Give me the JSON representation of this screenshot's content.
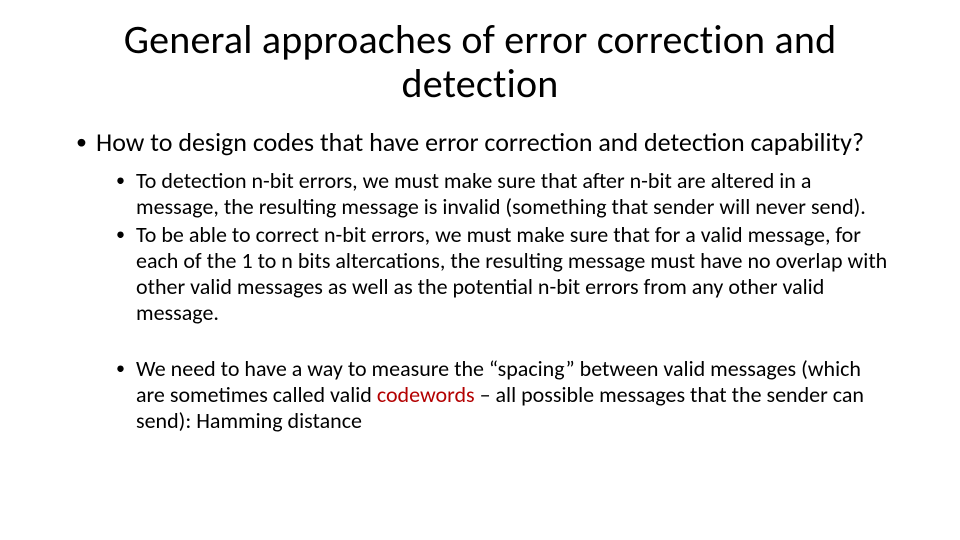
{
  "title": "General approaches of error correction and detection",
  "body": {
    "question": "How to design codes that have error correction and detection capability?",
    "points": {
      "p1": "To detection n-bit errors, we must make sure that after n-bit are altered in a message, the resulting message is invalid (something that sender will never send).",
      "p2": "To be able to correct n-bit errors, we must make sure that for a valid message, for each of the 1 to n bits altercations, the resulting message must have no overlap with other valid messages as well as the potential n-bit errors from any other valid message.",
      "p3_pre": "We need to have a way to measure the “spacing” between valid messages (which are sometimes called valid ",
      "p3_codeword": "codewords",
      "p3_post": " – all possible messages that the sender can send): Hamming distance"
    }
  }
}
